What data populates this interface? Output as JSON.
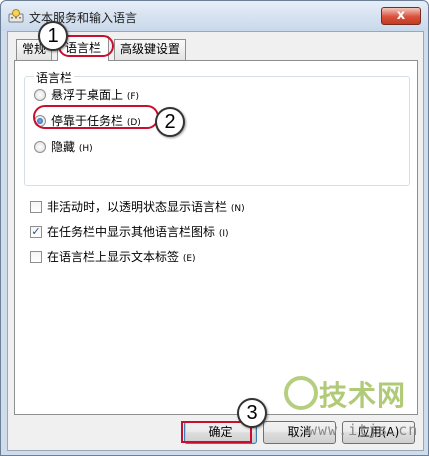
{
  "window": {
    "title": "文本服务和输入语言",
    "close_label": "x"
  },
  "tabs": [
    {
      "label": "常规",
      "active": false
    },
    {
      "label": "语言栏",
      "active": true
    },
    {
      "label": "高级键设置",
      "active": false
    }
  ],
  "language_bar": {
    "group_title": "语言栏",
    "options": [
      {
        "label": "悬浮于桌面上",
        "accel": "(F)",
        "checked": false
      },
      {
        "label": "停靠于任务栏",
        "accel": "(D)",
        "checked": true
      },
      {
        "label": "隐藏",
        "accel": "(H)",
        "checked": false
      }
    ]
  },
  "checkboxes": [
    {
      "label": "非活动时，以透明状态显示语言栏",
      "accel": "(N)",
      "checked": false
    },
    {
      "label": "在任务栏中显示其他语言栏图标",
      "accel": "(I)",
      "checked": true
    },
    {
      "label": "在语言栏上显示文本标签",
      "accel": "(E)",
      "checked": false
    }
  ],
  "buttons": {
    "ok": "确定",
    "cancel": "取消",
    "apply": "应用(A)"
  },
  "callouts": [
    "1",
    "2",
    "3"
  ],
  "watermark": {
    "text": "技术网",
    "url": "www.itjs.cn"
  },
  "colors": {
    "highlight": "#c8102e",
    "title_bg": "#cfdcec",
    "watermark": "#a9c56a"
  }
}
